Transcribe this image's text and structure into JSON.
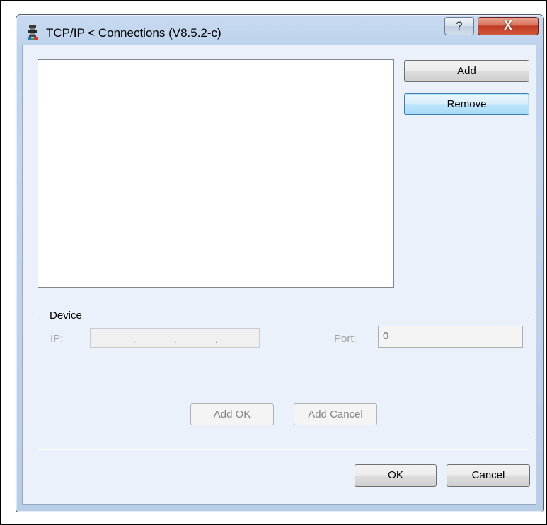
{
  "window": {
    "title": "TCP/IP < Connections  (V8.5.2-c)",
    "app_icon": "device-tower-icon",
    "help_glyph": "?",
    "close_glyph": "X"
  },
  "connections": {
    "items": [],
    "add_label": "Add",
    "remove_label": "Remove"
  },
  "device": {
    "group_label": "Device",
    "ip_label": "IP:",
    "ip_value": ".  .  .",
    "port_label": "Port:",
    "port_value": "0",
    "add_ok_label": "Add OK",
    "add_cancel_label": "Add Cancel"
  },
  "footer": {
    "ok_label": "OK",
    "cancel_label": "Cancel"
  },
  "colors": {
    "accent_focus": "#3c7fb1",
    "close_red": "#c03a22",
    "client_bg": "#eaf1fa",
    "disabled_text": "#838383"
  }
}
